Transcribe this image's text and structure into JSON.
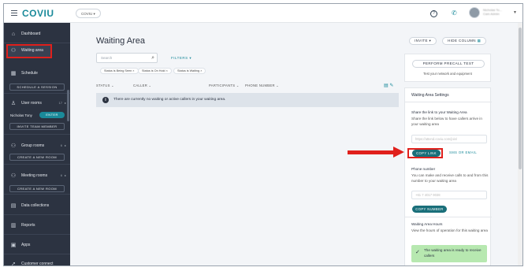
{
  "header": {
    "logo": "COVIU",
    "org_select": "COVIU ▾",
    "help_icon": "?",
    "user_name_line1": "Nicholas To...",
    "user_name_line2": "Cam Admin"
  },
  "sidebar": {
    "dashboard": "Dashboard",
    "waiting_area": "Waiting area",
    "schedule": "Schedule",
    "schedule_session": "SCHEDULE A SESSION",
    "user_rooms": "User rooms",
    "user_rooms_count": "17",
    "user_name": "Nicholas Tony",
    "enter": "ENTER",
    "invite_team_member": "INVITE TEAM MEMBER",
    "group_rooms": "Group rooms",
    "group_rooms_count": "6",
    "create_room_1": "CREATE A NEW ROOM",
    "meeting_rooms": "Meeting rooms",
    "meeting_rooms_count": "6",
    "create_room_2": "CREATE A NEW ROOM",
    "data_collections": "Data collections",
    "reports": "Reports",
    "apps": "Apps",
    "customer_connect": "Customer connect"
  },
  "main": {
    "title": "Waiting Area",
    "invite": "INVITE ▾",
    "hide_column": "HIDE COLUMN",
    "search_placeholder": "Search",
    "filters": "FILTERS ▾",
    "chips": [
      "Status is Being Seen  ×",
      "Status is On Hold  ×",
      "Status is Waiting  ×"
    ],
    "columns": [
      "STATUS  ⌄",
      "CALLER  ⌄",
      "PARTICIPANTS  ⌄",
      "PHONE NUMBER  ⌄"
    ],
    "empty_message": "There are currently no waiting or active callers in your waiting area."
  },
  "right_panel": {
    "precall_button": "PERFORM PRECALL TEST",
    "precall_text": "Test your network and equipment",
    "settings_title": "Waiting Area Settings",
    "share_head": "Share the link to your Waiting Area",
    "share_text": "Share the link below to have callers arrive in your waiting area",
    "link_value": "https://attend.coviu.com/join/",
    "copy_link": "COPY LINK",
    "sms_email": "SMS OR EMAIL",
    "phone_head": "Phone number",
    "phone_text": "You can make and receive calls to and from this number to your waiting area",
    "phone_value": "+61 7 4017 9038",
    "copy_number": "COPY NUMBER",
    "hours_head": "Waiting Area Hours",
    "hours_text": "View the hours of operation for this waiting area",
    "ready_text": "The waiting area is ready to receive callers"
  }
}
